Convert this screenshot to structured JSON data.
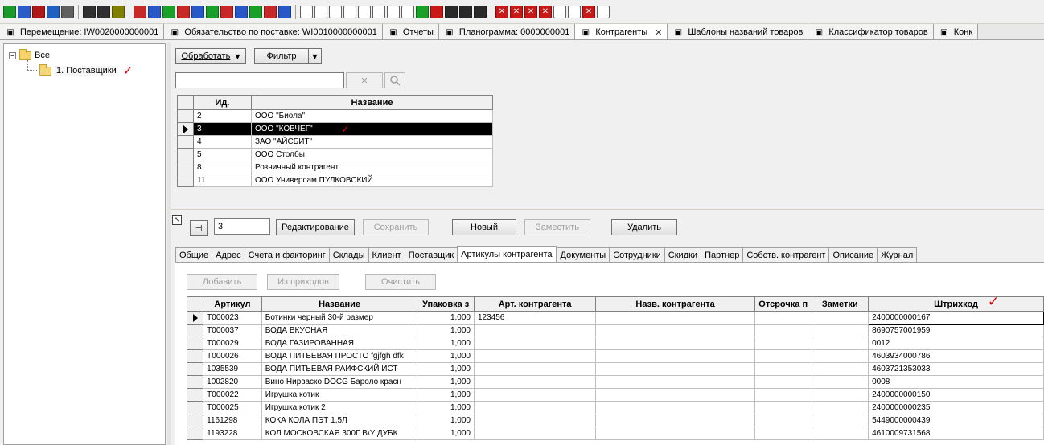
{
  "toolbar": {
    "icons": [
      "cash-register",
      "life-ring",
      "shop",
      "cart",
      "copy",
      "list",
      "barcode",
      "price-tag",
      "tree-1",
      "tree-2",
      "tree-3",
      "tree-4",
      "tree-5",
      "tree-6",
      "tree-7",
      "tree-8",
      "tree-9",
      "tree-10",
      "tree-11",
      "doc-1",
      "doc-2",
      "doc-3",
      "doc-4",
      "doc-5",
      "doc-6",
      "doc-7",
      "doc-8",
      "book-green",
      "book-red",
      "report-1",
      "report-2",
      "report-3",
      "cancel-1",
      "cancel-2",
      "cancel-3",
      "money-cancel",
      "doc-cancel-1",
      "doc-cancel-2",
      "cancel-4",
      "doc-cancel-3"
    ]
  },
  "doc_tabs": [
    {
      "icon": "doc-icon",
      "label": "Перемещение: IW0020000000001"
    },
    {
      "icon": "doc-icon",
      "label": "Обязательство по поставке: WI0010000000001"
    },
    {
      "icon": "copy-icon",
      "label": "Отчеты"
    },
    {
      "icon": "planogram-icon",
      "label": "Планограмма: 0000000001"
    },
    {
      "icon": "contractor-icon",
      "label": "Контрагенты",
      "active": true,
      "close": "✕"
    },
    {
      "icon": "template-icon",
      "label": "Шаблоны названий товаров"
    },
    {
      "icon": "classifier-icon",
      "label": "Классификатор товаров"
    },
    {
      "icon": "table-icon",
      "label": "Конк"
    }
  ],
  "tree": {
    "root_label": "Все",
    "root_toggle": "−",
    "child_label": "1. Поставщики"
  },
  "upper": {
    "process_label": "Обработать",
    "filter_label": "Фильтр",
    "search_value": "",
    "clear_icon": "✕",
    "search_icon": "magnifier"
  },
  "contractors": {
    "columns": [
      "Ид.",
      "Название"
    ],
    "rows": [
      {
        "id": "2",
        "name": "ООО \"Биола\""
      },
      {
        "id": "3",
        "name": "ООО \"КОВЧЕГ\"",
        "selected": true
      },
      {
        "id": "4",
        "name": "ЗАО \"АЙСБИТ\""
      },
      {
        "id": "5",
        "name": "ООО Столбы"
      },
      {
        "id": "8",
        "name": "Розничный контрагент"
      },
      {
        "id": "11",
        "name": "ООО Универсам ПУЛКОВСКИЙ"
      }
    ]
  },
  "editor": {
    "id_value": "3",
    "edit_label": "Редактирование",
    "save_label": "Сохранить",
    "new_label": "Новый",
    "replace_label": "Заместить",
    "delete_label": "Удалить"
  },
  "detail_tabs": [
    "Общие",
    "Адрес",
    "Счета и факторинг",
    "Склады",
    "Клиент",
    "Поставщик",
    "Артикулы контрагента",
    "Документы",
    "Сотрудники",
    "Скидки",
    "Партнер",
    "Собств. контрагент",
    "Описание",
    "Журнал"
  ],
  "detail_active_tab": "Артикулы контрагента",
  "articles_toolbar": {
    "add_label": "Добавить",
    "from_receipts_label": "Из приходов",
    "clear_label": "Очистить"
  },
  "articles": {
    "columns": [
      "Артикул",
      "Название",
      "Упаковка з",
      "Арт. контрагента",
      "Назв. контрагента",
      "Отсрочка п",
      "Заметки",
      "Штрихкод"
    ],
    "rows": [
      {
        "art": "T000023",
        "name": "Ботинки черный 30-й размер",
        "pack": "1,000",
        "c_art": "123456",
        "c_name": "",
        "delay": "",
        "notes": "",
        "barcode": "2400000000167",
        "current": true
      },
      {
        "art": "T000037",
        "name": "ВОДА ВКУСНАЯ",
        "pack": "1,000",
        "c_art": "",
        "c_name": "",
        "delay": "",
        "notes": "",
        "barcode": "8690757001959"
      },
      {
        "art": "T000029",
        "name": "ВОДА ГАЗИРОВАННАЯ",
        "pack": "1,000",
        "c_art": "",
        "c_name": "",
        "delay": "",
        "notes": "",
        "barcode": "0012"
      },
      {
        "art": "T000026",
        "name": "ВОДА ПИТЬЕВАЯ ПРОСТО fgjfgh dfk",
        "pack": "1,000",
        "c_art": "",
        "c_name": "",
        "delay": "",
        "notes": "",
        "barcode": "4603934000786"
      },
      {
        "art": "1035539",
        "name": "ВОДА ПИТЬЕВАЯ РАИФСКИЙ ИСТ",
        "pack": "1,000",
        "c_art": "",
        "c_name": "",
        "delay": "",
        "notes": "",
        "barcode": "4603721353033"
      },
      {
        "art": "1002820",
        "name": "Вино Нирваско  DOCG Бароло красн",
        "pack": "1,000",
        "c_art": "",
        "c_name": "",
        "delay": "",
        "notes": "",
        "barcode": "0008"
      },
      {
        "art": "T000022",
        "name": "Игрушка котик",
        "pack": "1,000",
        "c_art": "",
        "c_name": "",
        "delay": "",
        "notes": "",
        "barcode": "2400000000150"
      },
      {
        "art": "T000025",
        "name": "Игрушка котик 2",
        "pack": "1,000",
        "c_art": "",
        "c_name": "",
        "delay": "",
        "notes": "",
        "barcode": "2400000000235"
      },
      {
        "art": "1161298",
        "name": "КОКА КОЛА ПЭТ 1,5Л",
        "pack": "1,000",
        "c_art": "",
        "c_name": "",
        "delay": "",
        "notes": "",
        "barcode": "5449000000439"
      },
      {
        "art": "1193228",
        "name": "КОЛ МОСКОВСКАЯ 300Г В\\У ДУБК",
        "pack": "1,000",
        "c_art": "",
        "c_name": "",
        "delay": "",
        "notes": "",
        "barcode": "4610009731568"
      }
    ]
  },
  "annotation_mark": "✓",
  "colors": {
    "selection": "#000000",
    "annotation": "#e00000"
  }
}
